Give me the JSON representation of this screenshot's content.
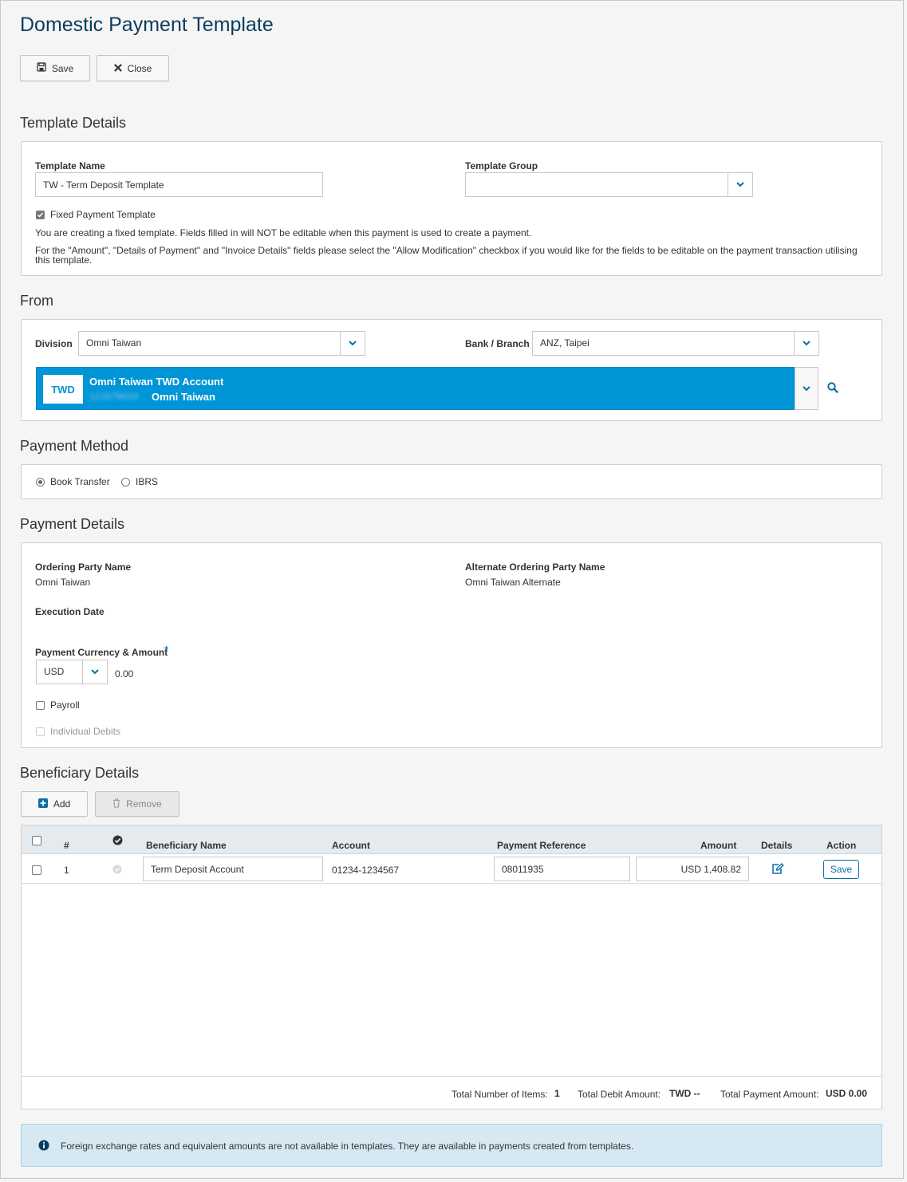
{
  "page": {
    "title": "Domestic Payment Template"
  },
  "toolbar": {
    "save_label": "Save",
    "close_label": "Close"
  },
  "template_details": {
    "section_title": "Template Details",
    "name_label": "Template Name",
    "name_value": "TW - Term Deposit Template",
    "group_label": "Template Group",
    "group_value": "",
    "fixed_label": "Fixed Payment Template",
    "fixed_checked": true,
    "note1": "You are creating a fixed template. Fields filled in will NOT be editable when this payment is used to create a payment.",
    "note2": "For the \"Amount\", \"Details of Payment\" and \"Invoice Details\" fields please select the \"Allow Modification\" checkbox if you would like for the fields to be editable on the payment transaction utilising this template."
  },
  "from": {
    "section_title": "From",
    "division_label": "Division",
    "division_value": "Omni Taiwan",
    "bank_label": "Bank / Branch",
    "bank_value": "ANZ, Taipei",
    "account": {
      "currency": "TWD",
      "name": "Omni Taiwan TWD Account",
      "number": "1218796S4",
      "owner": "Omni Taiwan"
    }
  },
  "payment_method": {
    "section_title": "Payment Method",
    "options": [
      "Book Transfer",
      "IBRS"
    ],
    "selected": "Book Transfer"
  },
  "payment_details": {
    "section_title": "Payment Details",
    "ordering_label": "Ordering Party Name",
    "ordering_value": "Omni Taiwan",
    "alt_ordering_label": "Alternate Ordering Party Name",
    "alt_ordering_value": "Omni Taiwan Alternate",
    "execution_label": "Execution Date",
    "currency_amount_label": "Payment Currency & Amount",
    "required_mark": "*",
    "currency_value": "USD",
    "amount_value": "0.00",
    "payroll_label": "Payroll",
    "individual_label": "Individual Debits"
  },
  "beneficiary": {
    "section_title": "Beneficiary Details",
    "add_label": "Add",
    "remove_label": "Remove",
    "headers": {
      "num": "#",
      "name": "Beneficiary Name",
      "account": "Account",
      "reference": "Payment Reference",
      "amount": "Amount",
      "details": "Details",
      "action": "Action"
    },
    "rows": [
      {
        "num": "1",
        "name": "Term Deposit Account",
        "account": "01234-1234567",
        "reference": "08011935",
        "amount": "USD 1,408.82",
        "action": "Save"
      }
    ],
    "footer": {
      "items_label": "Total Number of Items:",
      "items_value": "1",
      "debit_label": "Total Debit Amount:",
      "debit_value": "TWD --",
      "payment_label": "Total Payment Amount:",
      "payment_value": "USD 0.00"
    }
  },
  "info": {
    "text": "Foreign exchange rates and equivalent amounts are not available in templates. They are available in payments created from templates."
  },
  "colors": {
    "accent": "#0095d6",
    "title": "#0b3c5d",
    "info_bg": "#d6e9f3"
  }
}
